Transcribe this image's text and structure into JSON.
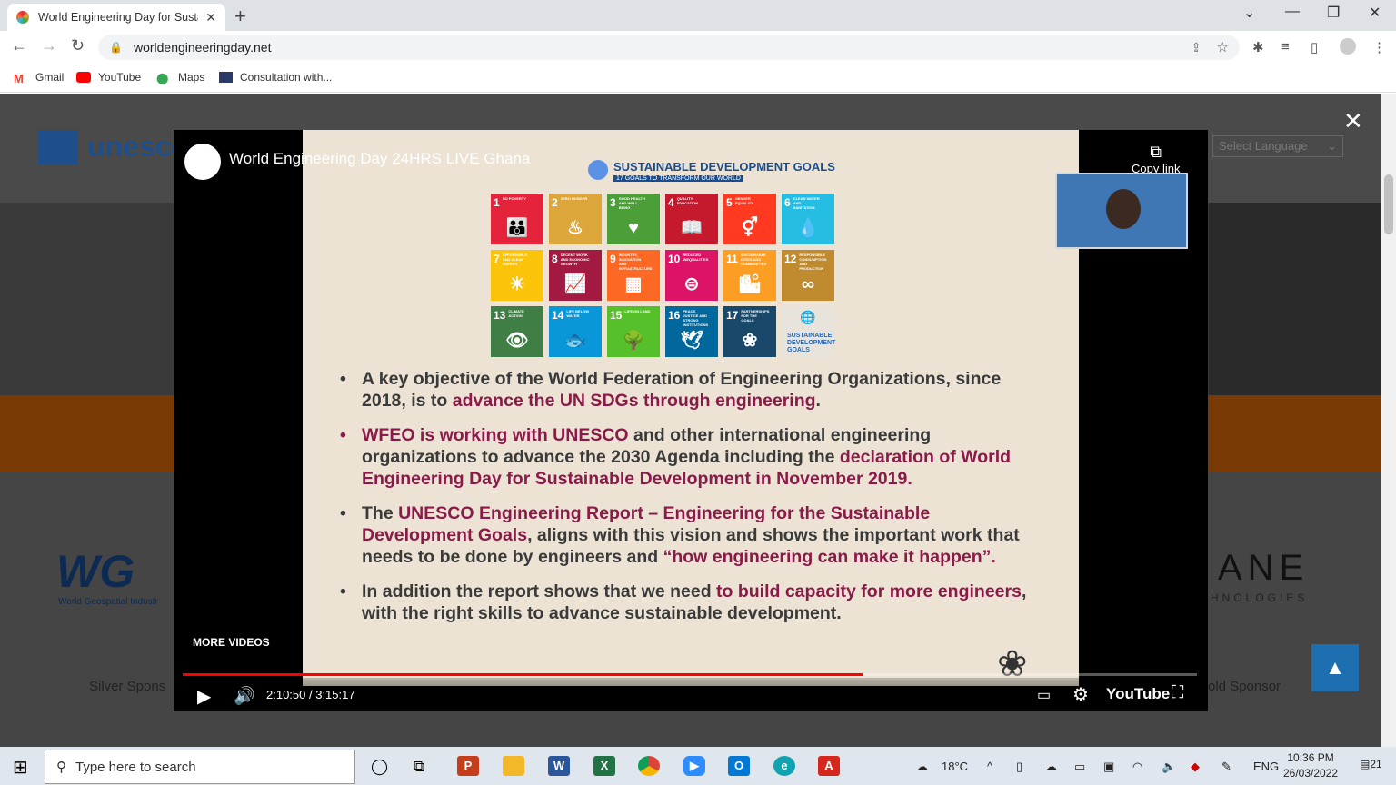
{
  "browser": {
    "tab_title": "World Engineering Day for Sustainable Development",
    "url": "worldengineeringday.net",
    "bookmarks": [
      "Gmail",
      "YouTube",
      "Maps",
      "Consultation with..."
    ]
  },
  "page": {
    "unesco": "unesco",
    "language_select": "Select Language",
    "wg_sub": "World Geospatial Industr",
    "silver_sponsor": "Silver Spons",
    "gold_sponsor": "old Sponsor",
    "partner_logo": "ANE",
    "partner_sub": "HNOLOGIES"
  },
  "video": {
    "title": "World Engineering Day 24HRS LIVE Ghana",
    "copy_link": "Copy link",
    "more_videos": "MORE VIDEOS",
    "time": "2:10:50 / 3:15:17",
    "progress": 0.67,
    "youtube_label": "YouTube",
    "slide_header": "SUSTAINABLE DEVELOPMENT GOALS",
    "slide_header_sub": "17 GOALS TO TRANSFORM OUR WORLD",
    "sdg_tiles": [
      {
        "n": "1",
        "label": "NO POVERTY",
        "color": "#e5243b",
        "glyph": "👪"
      },
      {
        "n": "2",
        "label": "ZERO HUNGER",
        "color": "#dda63a",
        "glyph": "♨"
      },
      {
        "n": "3",
        "label": "GOOD HEALTH AND WELL-BEING",
        "color": "#4c9f38",
        "glyph": "♥"
      },
      {
        "n": "4",
        "label": "QUALITY EDUCATION",
        "color": "#c5192d",
        "glyph": "📖"
      },
      {
        "n": "5",
        "label": "GENDER EQUALITY",
        "color": "#ff3a21",
        "glyph": "⚥"
      },
      {
        "n": "6",
        "label": "CLEAN WATER AND SANITATION",
        "color": "#26bde2",
        "glyph": "💧"
      },
      {
        "n": "7",
        "label": "AFFORDABLE AND CLEAN ENERGY",
        "color": "#fcc30b",
        "glyph": "☀"
      },
      {
        "n": "8",
        "label": "DECENT WORK AND ECONOMIC GROWTH",
        "color": "#a21942",
        "glyph": "📈"
      },
      {
        "n": "9",
        "label": "INDUSTRY, INNOVATION AND INFRASTRUCTURE",
        "color": "#fd6925",
        "glyph": "▦"
      },
      {
        "n": "10",
        "label": "REDUCED INEQUALITIES",
        "color": "#dd1367",
        "glyph": "⊜"
      },
      {
        "n": "11",
        "label": "SUSTAINABLE CITIES AND COMMUNITIES",
        "color": "#fd9d24",
        "glyph": "🏙"
      },
      {
        "n": "12",
        "label": "RESPONSIBLE CONSUMPTION AND PRODUCTION",
        "color": "#bf8b2e",
        "glyph": "∞"
      },
      {
        "n": "13",
        "label": "CLIMATE ACTION",
        "color": "#3f7e44",
        "glyph": "👁"
      },
      {
        "n": "14",
        "label": "LIFE BELOW WATER",
        "color": "#0a97d9",
        "glyph": "🐟"
      },
      {
        "n": "15",
        "label": "LIFE ON LAND",
        "color": "#56c02b",
        "glyph": "🌳"
      },
      {
        "n": "16",
        "label": "PEACE, JUSTICE AND STRONG INSTITUTIONS",
        "color": "#00689d",
        "glyph": "🕊"
      },
      {
        "n": "17",
        "label": "PARTNERSHIPS FOR THE GOALS",
        "color": "#19486a",
        "glyph": "❀"
      },
      {
        "n": "",
        "label": "SUSTAINABLE DEVELOPMENT GOALS",
        "color": "#e8e4dc",
        "glyph": "🌐"
      }
    ],
    "bullets": [
      {
        "a": "A key objective of the World Federation of Engineering Organizations, since 2018, is to ",
        "b": "advance the UN SDGs through engineering",
        "c": "."
      },
      {
        "a": "",
        "b": "WFEO is working with UNESCO",
        "c": " and other international engineering organizations to advance the 2030 Agenda including the ",
        "d": "declaration of World Engineering Day for Sustainable Development in November 2019."
      },
      {
        "a": "The ",
        "b": "UNESCO Engineering Report – Engineering for the Sustainable Development Goals",
        "c": ", aligns with this vision and shows the important work that needs to be done by engineers and ",
        "d": "“how engineering can make it happen”."
      },
      {
        "a": "In addition the report shows that we need ",
        "b": "to build capacity for more engineers",
        "c": ", with the right skills to advance sustainable development."
      }
    ]
  },
  "taskbar": {
    "search_placeholder": "Type here to search",
    "temperature": "18°C",
    "lang": "ENG",
    "time": "10:36 PM",
    "date": "26/03/2022",
    "notifications": "21"
  }
}
